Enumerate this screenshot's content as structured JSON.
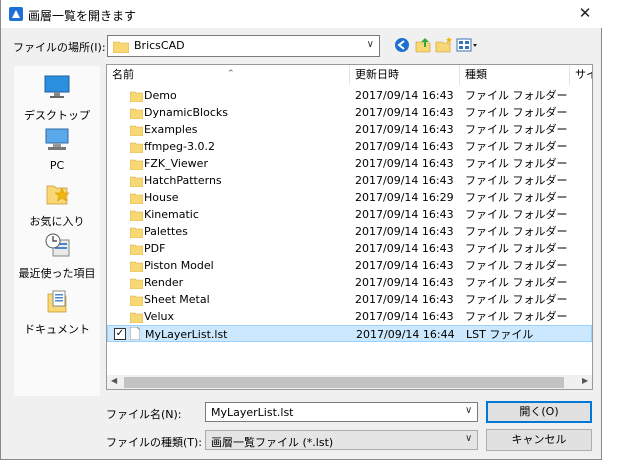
{
  "title": "画層一覧を開きます",
  "close_glyph": "✕",
  "look_in": {
    "label": "ファイルの場所(I):",
    "value": "BricsCAD"
  },
  "places": [
    {
      "label": "デスクトップ",
      "icon": "desktop-icon"
    },
    {
      "label": "PC",
      "icon": "pc-icon"
    },
    {
      "label": "お気に入り",
      "icon": "favorites-icon"
    },
    {
      "label": "最近使った項目",
      "icon": "recent-icon"
    },
    {
      "label": "ドキュメント",
      "icon": "documents-icon"
    }
  ],
  "columns": {
    "name": "名前",
    "date": "更新日時",
    "type": "種類",
    "size": "サイズ"
  },
  "files": [
    {
      "name": "Demo",
      "date": "2017/09/14 16:43",
      "type": "ファイル フォルダー"
    },
    {
      "name": "DynamicBlocks",
      "date": "2017/09/14 16:43",
      "type": "ファイル フォルダー"
    },
    {
      "name": "Examples",
      "date": "2017/09/14 16:43",
      "type": "ファイル フォルダー"
    },
    {
      "name": "ffmpeg-3.0.2",
      "date": "2017/09/14 16:43",
      "type": "ファイル フォルダー"
    },
    {
      "name": "FZK_Viewer",
      "date": "2017/09/14 16:43",
      "type": "ファイル フォルダー"
    },
    {
      "name": "HatchPatterns",
      "date": "2017/09/14 16:43",
      "type": "ファイル フォルダー"
    },
    {
      "name": "House",
      "date": "2017/09/14 16:29",
      "type": "ファイル フォルダー"
    },
    {
      "name": "Kinematic",
      "date": "2017/09/14 16:43",
      "type": "ファイル フォルダー"
    },
    {
      "name": "Palettes",
      "date": "2017/09/14 16:43",
      "type": "ファイル フォルダー"
    },
    {
      "name": "PDF",
      "date": "2017/09/14 16:43",
      "type": "ファイル フォルダー"
    },
    {
      "name": "Piston Model",
      "date": "2017/09/14 16:43",
      "type": "ファイル フォルダー"
    },
    {
      "name": "Render",
      "date": "2017/09/14 16:43",
      "type": "ファイル フォルダー"
    },
    {
      "name": "Sheet Metal",
      "date": "2017/09/14 16:43",
      "type": "ファイル フォルダー"
    },
    {
      "name": "Velux",
      "date": "2017/09/14 16:43",
      "type": "ファイル フォルダー"
    },
    {
      "name": "MyLayerList.lst",
      "date": "2017/09/14 16:44",
      "type": "LST ファイル"
    }
  ],
  "filename": {
    "label": "ファイル名(N):",
    "value": "MyLayerList.lst"
  },
  "filetype": {
    "label": "ファイルの種類(T):",
    "value": "画層一覧ファイル (*.lst)"
  },
  "buttons": {
    "open": "開く(O)",
    "cancel": "キャンセル"
  },
  "colors": {
    "selection": "#cce8ff",
    "accent": "#0078d7",
    "folder": "#f8d775"
  }
}
